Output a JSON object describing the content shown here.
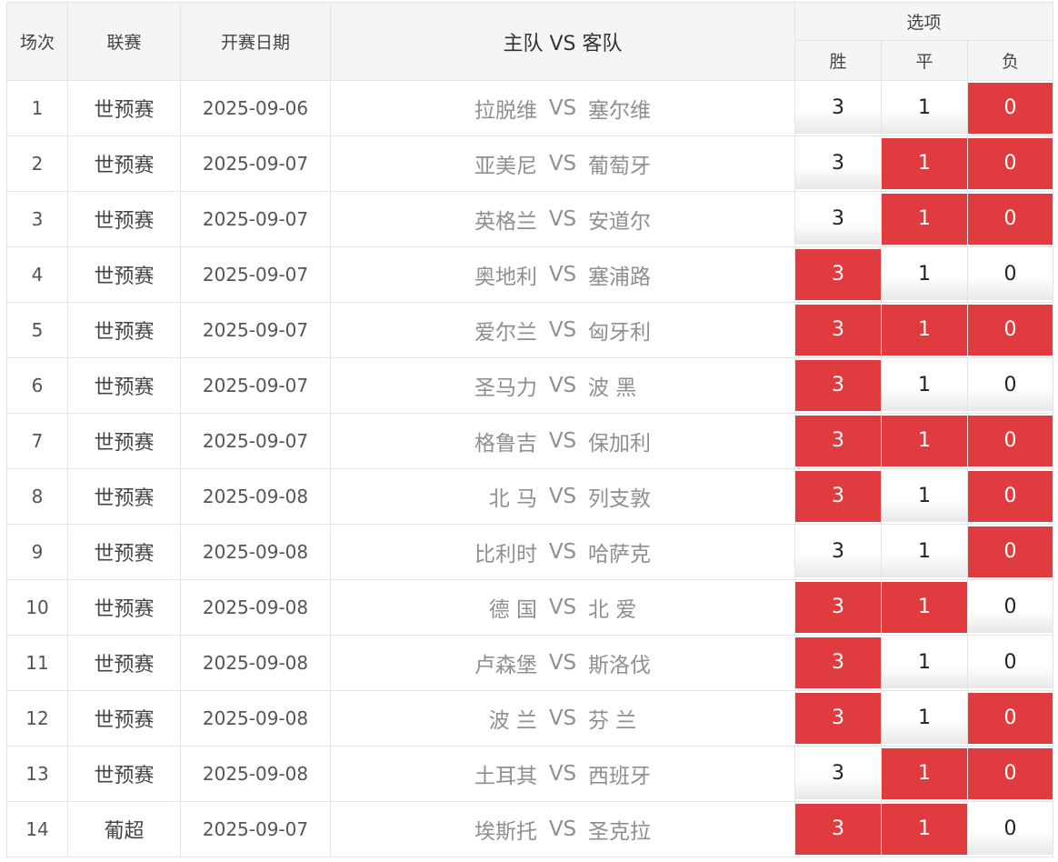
{
  "header": {
    "col_num": "场次",
    "col_league": "联赛",
    "col_date": "开赛日期",
    "col_match": "主队 VS 客队",
    "col_options": "选项",
    "opt_win": "胜",
    "opt_draw": "平",
    "opt_lose": "负"
  },
  "colors": {
    "selected_bg": "#e03b3e",
    "selected_text": "#ffffff",
    "header_bg": "#f5f5f5",
    "team_text": "#8f8f8f"
  },
  "rows": [
    {
      "num": "1",
      "league": "世预赛",
      "date": "2025-09-06",
      "home": "拉脱维",
      "vs": "VS",
      "away": "塞尔维",
      "win": "3",
      "draw": "1",
      "lose": "0",
      "win_sel": false,
      "draw_sel": false,
      "lose_sel": true
    },
    {
      "num": "2",
      "league": "世预赛",
      "date": "2025-09-07",
      "home": "亚美尼",
      "vs": "VS",
      "away": "葡萄牙",
      "win": "3",
      "draw": "1",
      "lose": "0",
      "win_sel": false,
      "draw_sel": true,
      "lose_sel": true
    },
    {
      "num": "3",
      "league": "世预赛",
      "date": "2025-09-07",
      "home": "英格兰",
      "vs": "VS",
      "away": "安道尔",
      "win": "3",
      "draw": "1",
      "lose": "0",
      "win_sel": false,
      "draw_sel": true,
      "lose_sel": true
    },
    {
      "num": "4",
      "league": "世预赛",
      "date": "2025-09-07",
      "home": "奥地利",
      "vs": "VS",
      "away": "塞浦路",
      "win": "3",
      "draw": "1",
      "lose": "0",
      "win_sel": true,
      "draw_sel": false,
      "lose_sel": false
    },
    {
      "num": "5",
      "league": "世预赛",
      "date": "2025-09-07",
      "home": "爱尔兰",
      "vs": "VS",
      "away": "匈牙利",
      "win": "3",
      "draw": "1",
      "lose": "0",
      "win_sel": true,
      "draw_sel": true,
      "lose_sel": true
    },
    {
      "num": "6",
      "league": "世预赛",
      "date": "2025-09-07",
      "home": "圣马力",
      "vs": "VS",
      "away": "波 黑",
      "win": "3",
      "draw": "1",
      "lose": "0",
      "win_sel": true,
      "draw_sel": false,
      "lose_sel": false
    },
    {
      "num": "7",
      "league": "世预赛",
      "date": "2025-09-07",
      "home": "格鲁吉",
      "vs": "VS",
      "away": "保加利",
      "win": "3",
      "draw": "1",
      "lose": "0",
      "win_sel": true,
      "draw_sel": true,
      "lose_sel": true
    },
    {
      "num": "8",
      "league": "世预赛",
      "date": "2025-09-08",
      "home": "北 马",
      "vs": "VS",
      "away": "列支敦",
      "win": "3",
      "draw": "1",
      "lose": "0",
      "win_sel": true,
      "draw_sel": false,
      "lose_sel": true
    },
    {
      "num": "9",
      "league": "世预赛",
      "date": "2025-09-08",
      "home": "比利时",
      "vs": "VS",
      "away": "哈萨克",
      "win": "3",
      "draw": "1",
      "lose": "0",
      "win_sel": false,
      "draw_sel": false,
      "lose_sel": true
    },
    {
      "num": "10",
      "league": "世预赛",
      "date": "2025-09-08",
      "home": "德 国",
      "vs": "VS",
      "away": "北 爱",
      "win": "3",
      "draw": "1",
      "lose": "0",
      "win_sel": true,
      "draw_sel": true,
      "lose_sel": false
    },
    {
      "num": "11",
      "league": "世预赛",
      "date": "2025-09-08",
      "home": "卢森堡",
      "vs": "VS",
      "away": "斯洛伐",
      "win": "3",
      "draw": "1",
      "lose": "0",
      "win_sel": true,
      "draw_sel": false,
      "lose_sel": false
    },
    {
      "num": "12",
      "league": "世预赛",
      "date": "2025-09-08",
      "home": "波 兰",
      "vs": "VS",
      "away": "芬 兰",
      "win": "3",
      "draw": "1",
      "lose": "0",
      "win_sel": true,
      "draw_sel": false,
      "lose_sel": true
    },
    {
      "num": "13",
      "league": "世预赛",
      "date": "2025-09-08",
      "home": "土耳其",
      "vs": "VS",
      "away": "西班牙",
      "win": "3",
      "draw": "1",
      "lose": "0",
      "win_sel": false,
      "draw_sel": true,
      "lose_sel": true
    },
    {
      "num": "14",
      "league": "葡超",
      "date": "2025-09-07",
      "home": "埃斯托",
      "vs": "VS",
      "away": "圣克拉",
      "win": "3",
      "draw": "1",
      "lose": "0",
      "win_sel": true,
      "draw_sel": true,
      "lose_sel": false
    }
  ]
}
